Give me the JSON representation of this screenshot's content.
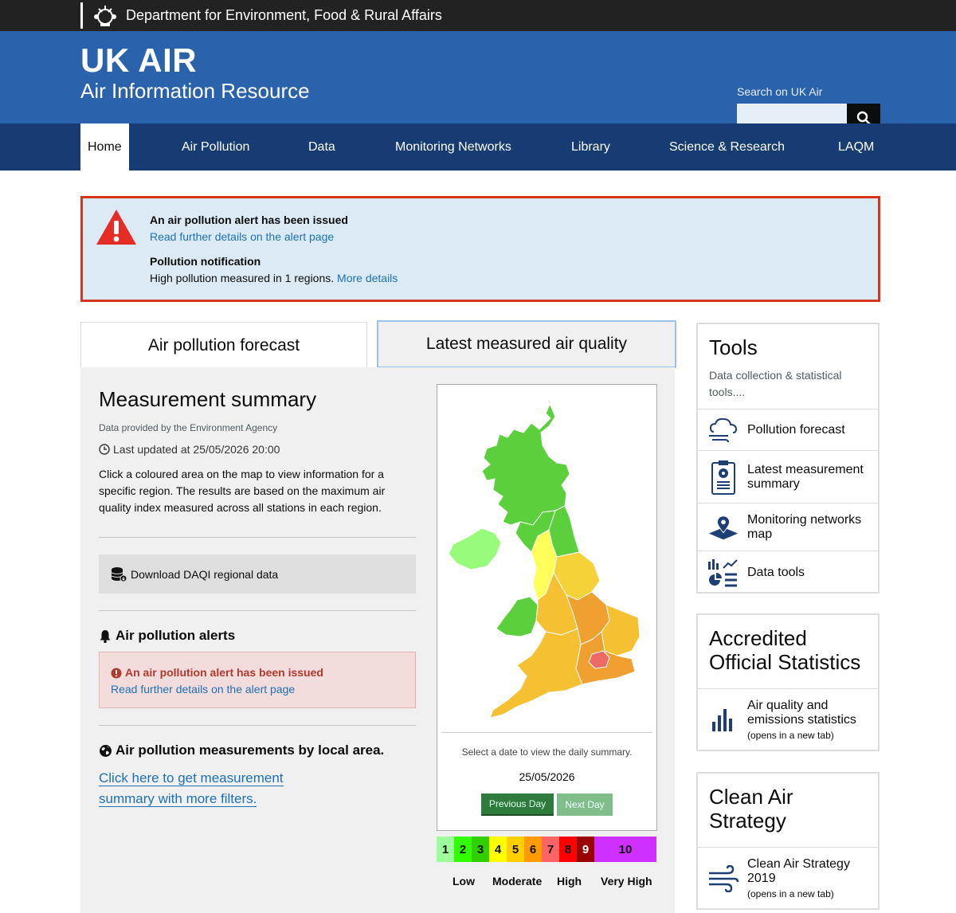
{
  "topbar": {
    "org": "Department for Environment, Food & Rural Affairs"
  },
  "header": {
    "title": "UK AIR",
    "subtitle": "Air Information Resource",
    "search_label": "Search on UK Air",
    "search_value": ""
  },
  "nav": [
    {
      "label": "Home",
      "active": true
    },
    {
      "label": "Air Pollution"
    },
    {
      "label": "Data"
    },
    {
      "label": "Monitoring Networks"
    },
    {
      "label": "Library"
    },
    {
      "label": "Science & Research"
    },
    {
      "label": "LAQM"
    }
  ],
  "alert_banner": {
    "heading": "An air pollution alert has been issued",
    "link": "Read further details on the alert page",
    "notif_heading": "Pollution notification",
    "notif_text": "High pollution measured in 1 regions.",
    "notif_link": "More details"
  },
  "tabs": {
    "forecast": "Air pollution forecast",
    "latest": "Latest measured air quality"
  },
  "summary": {
    "title": "Measurement summary",
    "provider": "Data provided by the Environment Agency",
    "updated": "Last updated at 25/05/2026 20:00",
    "description": "Click a coloured area on the map to view information for a specific region. The results are based on the maximum air quality index measured across all stations in each region.",
    "download": "Download DAQI regional data",
    "alerts_heading": "Air pollution alerts",
    "alert_title": "An air pollution alert has been issued",
    "alert_link": "Read further details on the alert page",
    "local_heading": "Air pollution measurements by local area.",
    "local_link": "Click here to get measurement summary with more filters."
  },
  "map": {
    "select_text": "Select a date to view the daily summary.",
    "date": "25/05/2026",
    "prev": "Previous Day",
    "next": "Next Day",
    "scale": [
      {
        "n": "1",
        "color": "#9cff9c"
      },
      {
        "n": "2",
        "color": "#31ff00"
      },
      {
        "n": "3",
        "color": "#31cf00"
      },
      {
        "n": "4",
        "color": "#ffff00"
      },
      {
        "n": "5",
        "color": "#ffcf00"
      },
      {
        "n": "6",
        "color": "#ff9a00"
      },
      {
        "n": "7",
        "color": "#ff6464"
      },
      {
        "n": "8",
        "color": "#ff0000"
      },
      {
        "n": "9",
        "color": "#990000"
      },
      {
        "n": "10",
        "color": "#ce30ff"
      }
    ],
    "bands": {
      "low": "Low",
      "moderate": "Moderate",
      "high": "High",
      "veryhigh": "Very High"
    }
  },
  "tools": {
    "title": "Tools",
    "desc": "Data collection & statistical tools....",
    "items": [
      "Pollution forecast",
      "Latest measurement summary",
      "Monitoring networks map",
      "Data tools"
    ]
  },
  "accredited": {
    "title": "Accredited Official Statistics",
    "item": "Air quality and emissions statistics",
    "note": "(opens in a new tab)"
  },
  "cleanair": {
    "title": "Clean Air Strategy",
    "item": "Clean Air Strategy 2019",
    "note": "(opens in a new tab)"
  }
}
